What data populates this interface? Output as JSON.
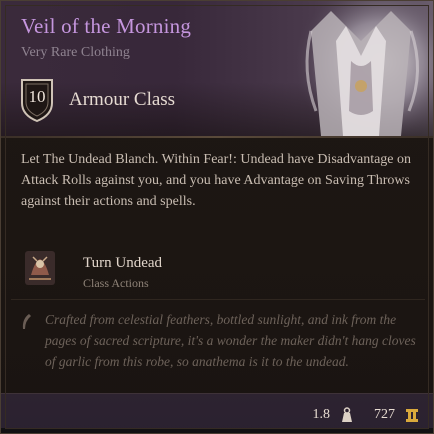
{
  "item": {
    "name": "Veil of the Morning",
    "rarity": "Very Rare Clothing"
  },
  "armour": {
    "value": "10",
    "label": "Armour Class"
  },
  "description": "Let The Undead Blanch. Within Fear!: Undead have Disadvantage on Attack Rolls against you, and you have Advantage on Saving Throws against their actions and spells.",
  "ability": {
    "name": "Turn Undead",
    "type": "Class Actions"
  },
  "flavor_text": "Crafted from celestial feathers, bottled sunlight, and ink from the pages of sacred scripture, it's a wonder the maker didn't hang cloves of garlic from this robe, so anathema is it to the undead.",
  "footer": {
    "weight": "1.8",
    "value": "727"
  },
  "colors": {
    "rarity_name": "#c596de",
    "header_bg": "#3a2a3b"
  },
  "icons": {
    "armour": "shield-icon",
    "ability": "turn-undead-icon",
    "weight": "weight-icon",
    "value": "gold-coin-icon",
    "flavor": "quill-icon"
  }
}
